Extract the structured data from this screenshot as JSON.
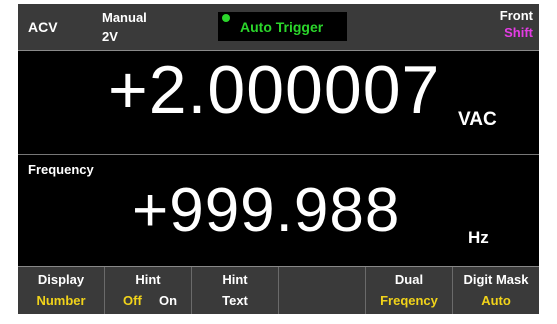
{
  "status": {
    "function": "ACV",
    "range_mode": "Manual",
    "range_value": "2V",
    "trigger": "Auto Trigger",
    "panel": "Front",
    "shift": "Shift"
  },
  "main": {
    "value": "+2.000007",
    "unit": "VAC"
  },
  "secondary": {
    "label": "Frequency",
    "value": "+999.988",
    "unit": "Hz"
  },
  "softkeys": [
    {
      "title": "Display",
      "value": "Number"
    },
    {
      "title": "Hint",
      "option_a": "Off",
      "option_b": "On"
    },
    {
      "title": "Hint",
      "value": "Text"
    },
    {
      "title": "",
      "value": ""
    },
    {
      "title": "Dual",
      "value": "Freqency"
    },
    {
      "title": "Digit Mask",
      "value": "Auto"
    }
  ],
  "colors": {
    "background": "#000000",
    "bar": "#3a3a3a",
    "trigger_green": "#2bd62b",
    "shift_magenta": "#e53ce5",
    "softkey_value_yellow": "#f1d31a"
  }
}
